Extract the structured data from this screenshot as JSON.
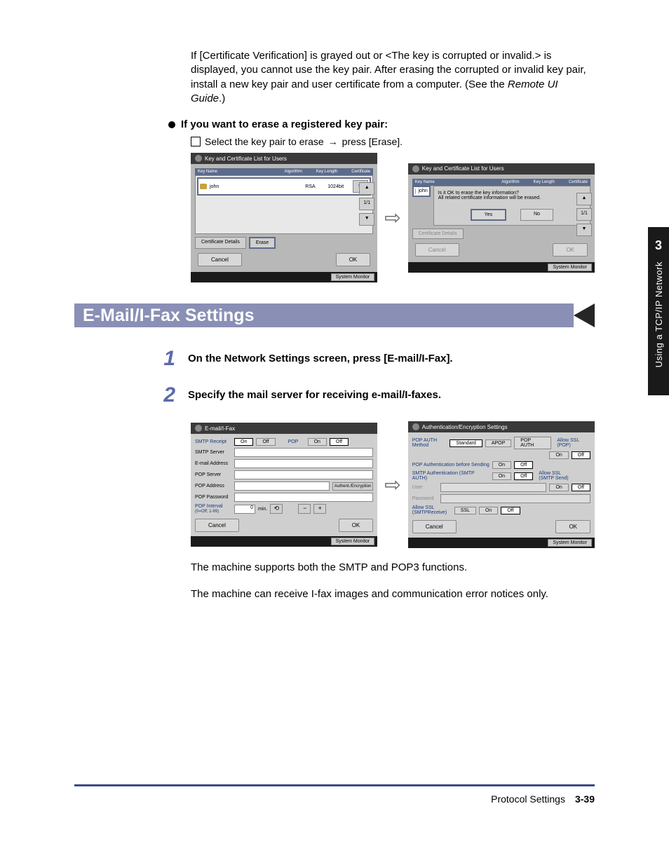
{
  "intro": {
    "p1a": "If [Certificate Verification] is grayed out or <The key is corrupted or invalid.> is displayed, you cannot use the key pair. After erasing the corrupted or invalid key pair, install a new key pair and user certificate from a computer. (See the ",
    "p1b": "Remote UI Guide",
    "p1c": ".)"
  },
  "erase": {
    "heading": "If you want to erase a registered key pair:",
    "sub_a": "Select the key pair to erase ",
    "arrow": "→",
    "sub_b": " press [Erase]."
  },
  "screen1": {
    "title": "Key and Certificate List for Users",
    "cols": {
      "name": "Key Name",
      "algo": "Algorithm",
      "len": "Key Length",
      "cert": "Certificate"
    },
    "row": {
      "name": "john",
      "algo": "RSA",
      "len": "1024bit"
    },
    "page": "1/1",
    "btn_cert": "Certificate Details",
    "btn_erase": "Erase",
    "cancel": "Cancel",
    "ok": "OK",
    "sysmon": "System Monitor"
  },
  "screen2": {
    "title": "Key and Certificate List for Users",
    "row_name": "john",
    "msg1": "Is it OK to erase the key information?",
    "msg2": "All related certificate information will be erased.",
    "yes": "Yes",
    "no": "No",
    "btn_cert": "Certificate Details",
    "page": "1/1",
    "cancel": "Cancel",
    "ok": "OK",
    "sysmon": "System Monitor"
  },
  "section_title": "E-Mail/I-Fax Settings",
  "steps": {
    "s1n": "1",
    "s1t": "On the Network Settings screen, press [E-mail/I-Fax].",
    "s2n": "2",
    "s2t": "Specify the mail server for receiving e-mail/I-faxes."
  },
  "screen3": {
    "title": "E-mail/I-Fax",
    "smtp_receipt": "SMTP Receipt",
    "on": "On",
    "off": "Off",
    "pop": "POP",
    "smtp_server": "SMTP Server",
    "email_addr": "E-mail Address",
    "pop_server": "POP Server",
    "pop_address": "POP Address",
    "pop_password": "POP Password",
    "auth_enc": "Authent./Encryption",
    "pop_interval": "POP Interval",
    "pop_interval_note": "(0=Off; 1-99)",
    "pop_val": "0",
    "min": "min.",
    "cancel": "Cancel",
    "ok": "OK",
    "sysmon": "System Monitor"
  },
  "screen4": {
    "title": "Authentication/Encryption Settings",
    "pop_auth": "POP AUTH Method",
    "standard": "Standard",
    "apop": "APOP",
    "popauth": "POP AUTH",
    "allow_ssl_pop": "Allow SSL (POP)",
    "on": "On",
    "off": "Off",
    "pop_before": "POP Authentication before Sending",
    "smtp_auth": "SMTP Authentication (SMTP AUTH)",
    "user": "User",
    "password": "Password",
    "allow_ssl_smtp_send": "Allow SSL (SMTP Send)",
    "allow_ssl_smtp_recv": "Allow SSL (SMTPReceive)",
    "ssl": "SSL",
    "cancel": "Cancel",
    "ok": "OK",
    "sysmon": "System Monitor"
  },
  "after": {
    "p1": "The machine supports both the SMTP and POP3 functions.",
    "p2": "The machine can receive I-fax images and communication error notices only."
  },
  "sidetab": {
    "num": "3",
    "text": "Using a TCP/IP Network"
  },
  "footer": {
    "section": "Protocol Settings",
    "page": "3-39"
  }
}
